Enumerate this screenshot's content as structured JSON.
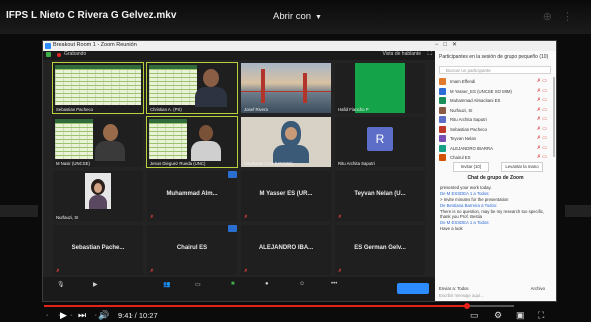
{
  "player": {
    "file_title": "IFPS L Nieto C Rivera G Gelvez.mkv",
    "open_with": "Abrir con",
    "progress": 0.9,
    "time": "9:41 / 10:27"
  },
  "zoom": {
    "window_title": "Breakout Room 1 - Zoom Reunión",
    "recording": "Grabando",
    "view": "Vista de hablante"
  },
  "tiles": [
    {
      "name": "Sebastian Pacheco"
    },
    {
      "name": "Christian A. (PS)"
    },
    {
      "name": "Josef Rivera"
    },
    {
      "name": "Hafid Fiancho P"
    },
    {
      "name": "M Nasir (UNCSE)"
    },
    {
      "name": "Jesus Dieguez Rueda (UNC)"
    },
    {
      "name": "Stephanie Cruz (UNCSE)"
    },
    {
      "name": "Ritu Archita Saputri"
    },
    {
      "name": "Nurfauzi, SI"
    },
    {
      "name": "Muhammad Alm...",
      "big": true
    },
    {
      "name": "M Yasser ES (UR...",
      "big": true
    },
    {
      "name": "Teyvan Nelan (U...",
      "big": true
    },
    {
      "name": "Sebastian Pache...",
      "big": true
    },
    {
      "name": "Chairul ES",
      "big": true
    },
    {
      "name": "ALEJANDRO IBA...",
      "big": true
    },
    {
      "name": "ES German Gelv...",
      "big": true
    }
  ],
  "panel": {
    "title": "Participantes en la sesión de grupo pequeño (10)",
    "search_placeholder": "Buscar un participante",
    "participants": [
      {
        "name": "Imam Effendi",
        "color": "#e07a2e"
      },
      {
        "name": "M Yasser_ES (UNCSE SO MIM)",
        "color": "#2d6bd6"
      },
      {
        "name": "Muhammad Almacitani ES",
        "color": "#1b8f5a"
      },
      {
        "name": "Nurfauzi, SI",
        "color": "#8a5a44"
      },
      {
        "name": "Ritu Archita Saputri",
        "color": "#5d6ec9"
      },
      {
        "name": "Sebastian Pacheco",
        "color": "#c0392b"
      },
      {
        "name": "Teyvan Nelan",
        "color": "#7a4fb5"
      },
      {
        "name": "ALEJANDRO IBARRA",
        "color": "#16a085"
      },
      {
        "name": "Chairul ES",
        "color": "#d35400"
      }
    ],
    "invite_label": "Invitar (10)",
    "raise_hand_label": "Levantar la mano",
    "chat_title": "Chat de grupo de Zoom",
    "chat": [
      {
        "from": "",
        "text": "presented your work today."
      },
      {
        "from": "De M ESSDEA 1 a Todos:",
        "text": "> Invite minutes for the presentation"
      },
      {
        "from": "De Bestiana Barreira a Todos:",
        "text": "There is no question, may be my research too specific, thank you Prof. Bestia"
      },
      {
        "from": "De M ESSDEA 1 a Todos:",
        "text": "Have a look"
      }
    ],
    "send_to_label": "Enviar a: Todos",
    "more_label": "Archivo",
    "hint": "Escribir mensaje aquí..."
  }
}
